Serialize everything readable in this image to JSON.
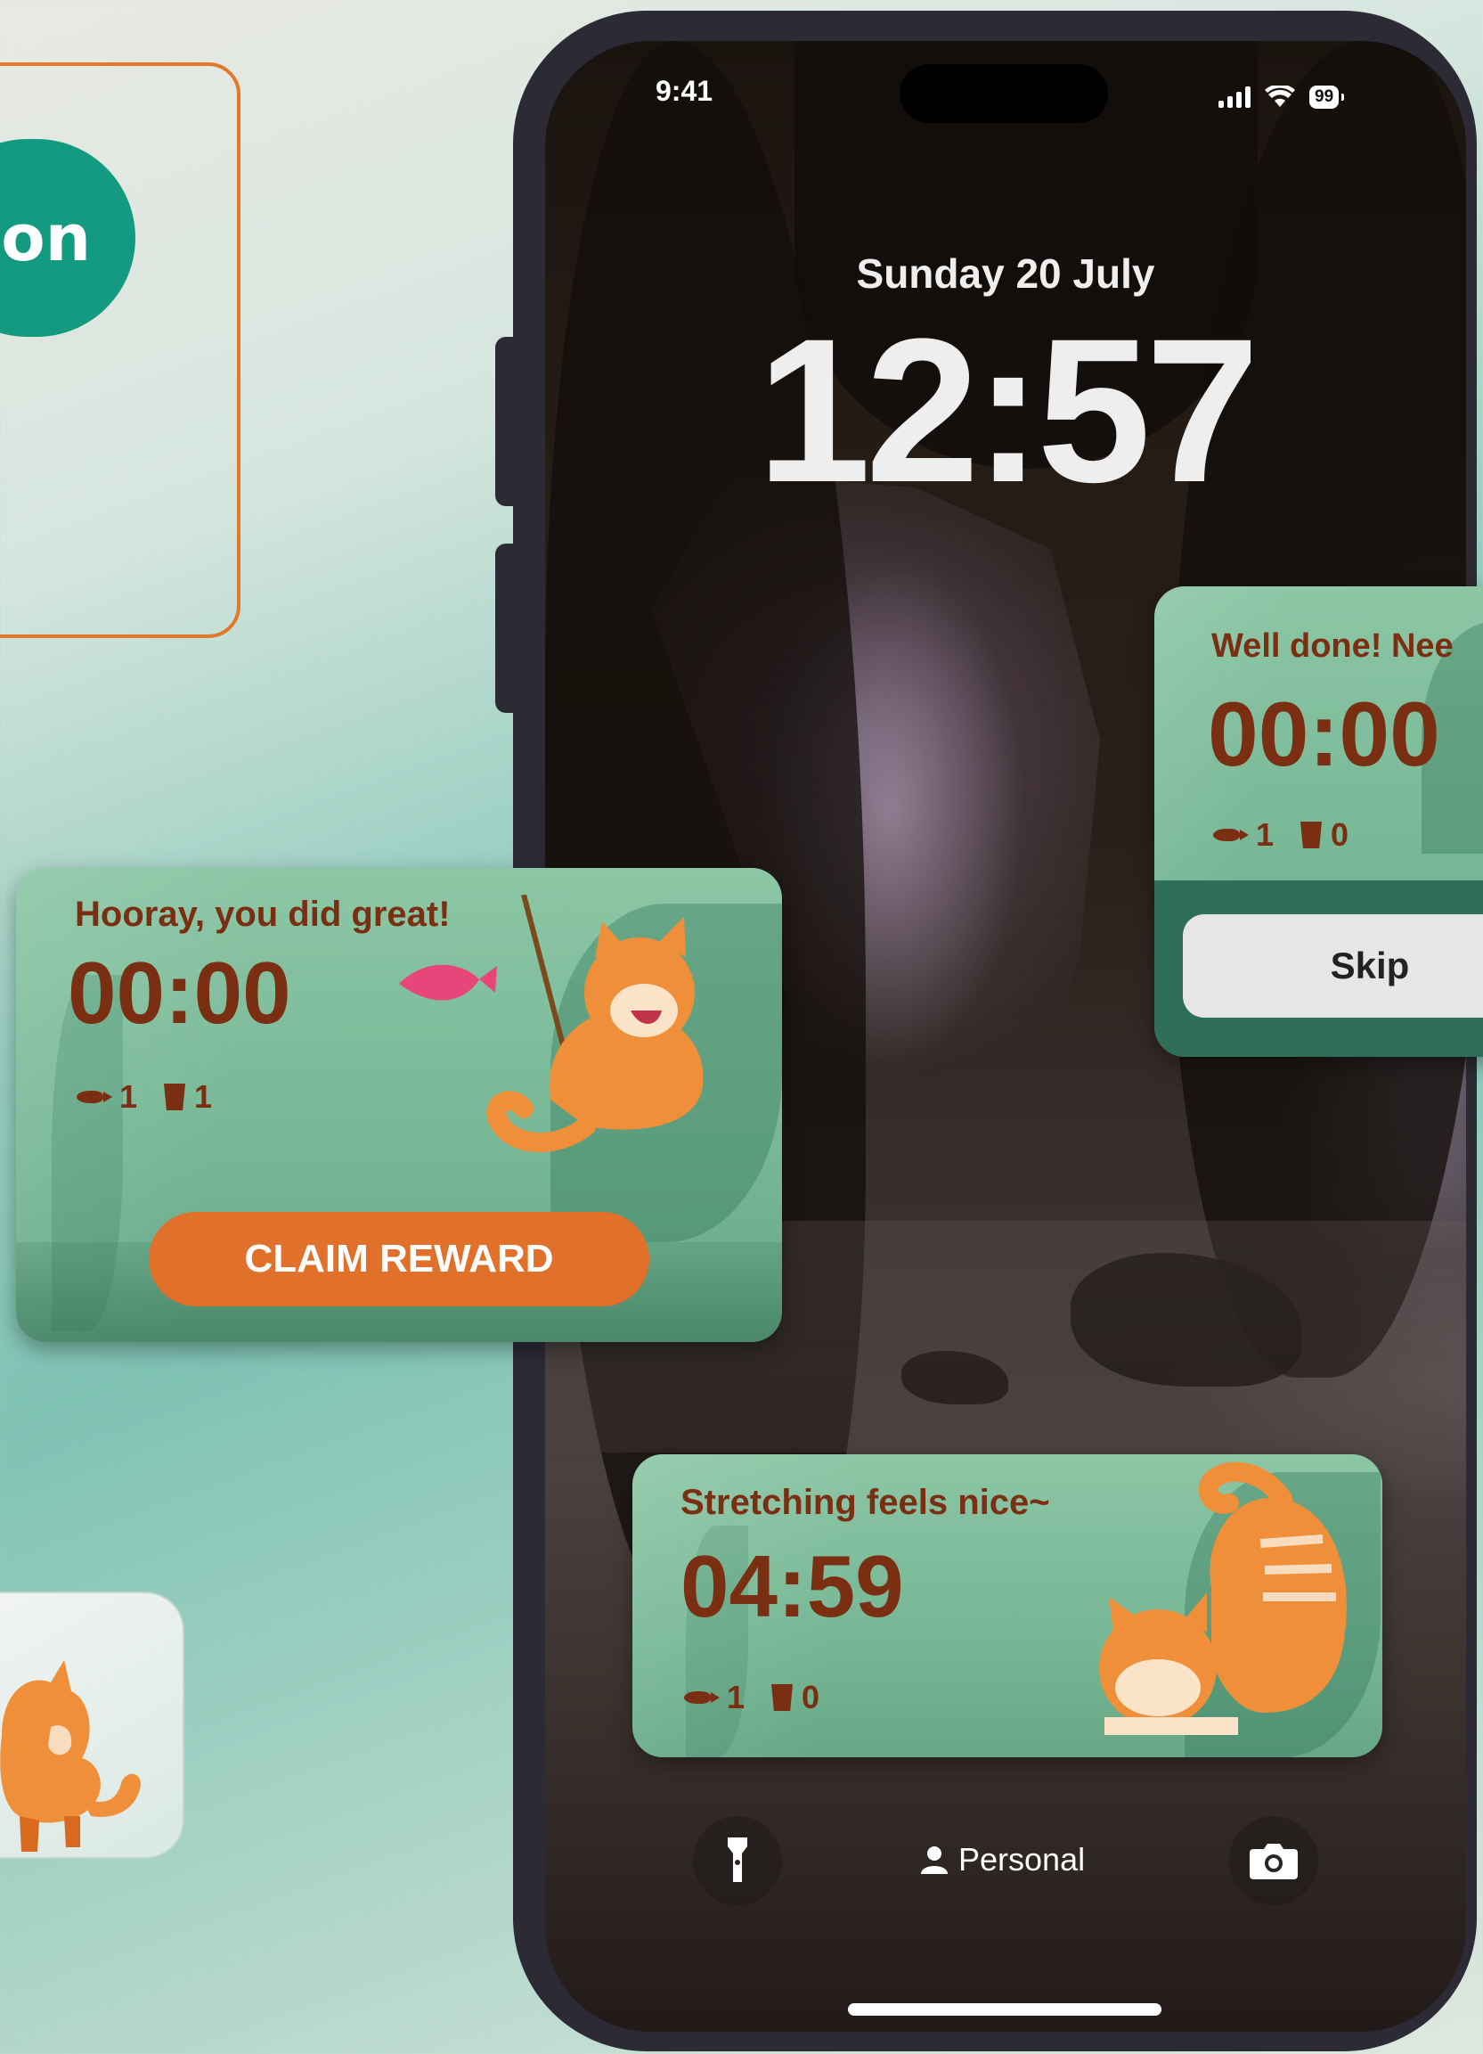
{
  "promo": {
    "pill_text": "on"
  },
  "status_bar": {
    "time": "9:41",
    "battery": "99"
  },
  "lock_screen": {
    "date": "Sunday 20 July",
    "time": "12:57"
  },
  "widget_right": {
    "caption": "Well done! Nee",
    "timer": "00:00",
    "fish_count": "1",
    "cup_count": "0",
    "button_label": "Skip"
  },
  "widget_left": {
    "caption": "Hooray, you did great!",
    "timer": "00:00",
    "fish_count": "1",
    "cup_count": "1",
    "button_label": "CLAIM REWARD"
  },
  "widget_bottom": {
    "caption": "Stretching feels nice~",
    "timer": "04:59",
    "fish_count": "1",
    "cup_count": "0"
  },
  "bottom_bar": {
    "focus_label": "Personal"
  },
  "colors": {
    "accent_orange": "#e0702a",
    "accent_teal": "#139a80",
    "text_brown": "#7a2e12",
    "widget_green": "#7bbb99"
  },
  "icons": [
    "flashlight-icon",
    "person-icon",
    "camera-icon",
    "fish-icon",
    "cup-icon",
    "wifi-icon",
    "signal-icon",
    "battery-icon"
  ]
}
